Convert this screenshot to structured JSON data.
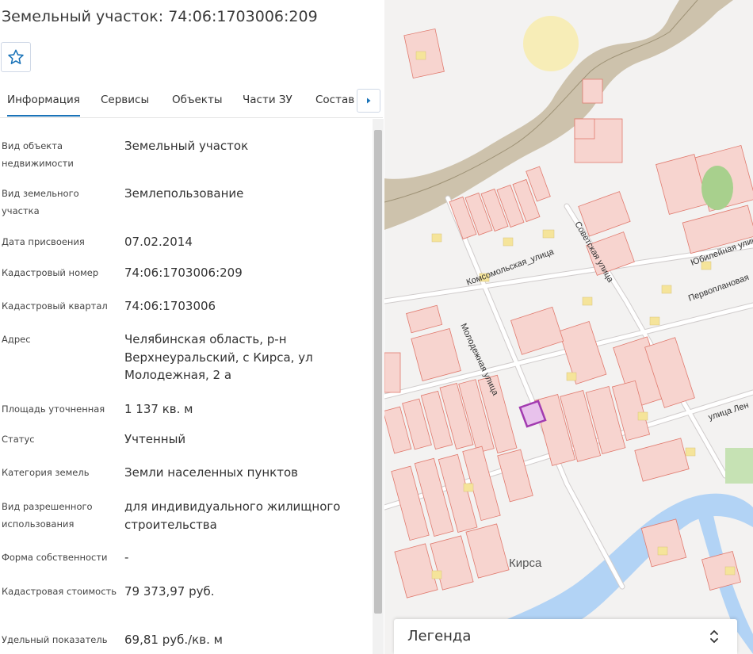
{
  "header": {
    "title": "Земельный участок: 74:06:1703006:209"
  },
  "favorite": {
    "icon": "star-outline-icon"
  },
  "tabs": [
    {
      "label": "Информация",
      "active": true
    },
    {
      "label": "Сервисы",
      "active": false
    },
    {
      "label": "Объекты",
      "active": false
    },
    {
      "label": "Части ЗУ",
      "active": false
    },
    {
      "label": "Состав",
      "active": false
    }
  ],
  "tab_next_icon": "caret-right-icon",
  "info": [
    {
      "label": "Вид объекта недвижимости",
      "value": "Земельный участок"
    },
    {
      "label": "Вид земельного участка",
      "value": "Землепользование"
    },
    {
      "label": "Дата присвоения",
      "value": "07.02.2014"
    },
    {
      "label": "Кадастровый номер",
      "value": "74:06:1703006:209"
    },
    {
      "label": "Кадастровый квартал",
      "value": "74:06:1703006"
    },
    {
      "label": "Адрес",
      "value": "Челябинская область, р-н Верхнеуральский, с Кирса, ул Молодежная, 2 а"
    },
    {
      "label": "Площадь уточненная",
      "value": "1 137 кв. м"
    },
    {
      "label": "Статус",
      "value": "Учтенный"
    },
    {
      "label": "Категория земель",
      "value": "Земли населенных пунктов"
    },
    {
      "label": "Вид разрешенного использования",
      "value": "для индивидуального жилищного строительства"
    },
    {
      "label": "Форма собственности",
      "value": "-"
    },
    {
      "label": "Кадастровая стоимость",
      "value": "79 373,97 руб."
    },
    {
      "label": "Удельный показатель",
      "value": "69,81 руб./кв. м"
    }
  ],
  "map": {
    "streets": [
      "Комсомольская_улица",
      "Советская улица",
      "Молодежная улица",
      "Юбилейная улица",
      "Первоплановая",
      "улица Лен"
    ],
    "place": "Кирса",
    "colors": {
      "parcel_fill": "#f7d4cf",
      "parcel_stroke": "#e07a6e",
      "selected_parcel": "#a23bb0",
      "water": "#b2d3f5",
      "building": "#f5e49a",
      "road_corridor": "#c9bda4"
    }
  },
  "legend": {
    "title": "Легенда",
    "icon": "chevron-up-down-icon"
  }
}
